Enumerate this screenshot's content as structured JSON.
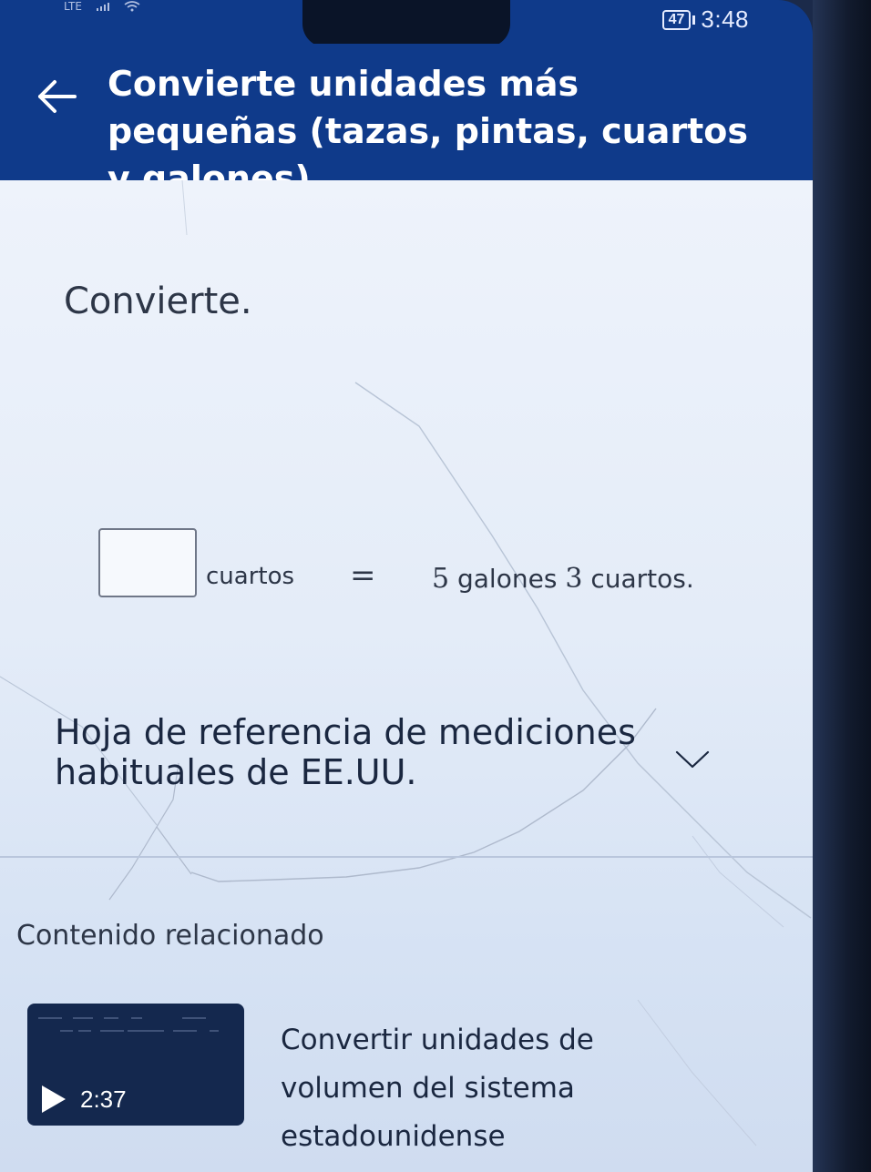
{
  "status_bar": {
    "network": "LTE",
    "battery": "47",
    "time": "3:48"
  },
  "header": {
    "title": "Convierte unidades más pequeñas (tazas, pintas, cuartos y galones)"
  },
  "exercise": {
    "prompt": "Convierte.",
    "answer_value": "",
    "unit_label": "cuartos",
    "equals": "=",
    "rhs_gallons": "5",
    "rhs_gallons_unit": "galones",
    "rhs_quarts": "3",
    "rhs_quarts_unit": "cuartos."
  },
  "reference": {
    "title": "Hoja de referencia de mediciones habituales de EE.UU."
  },
  "related": {
    "title": "Contenido relacionado",
    "video": {
      "duration": "2:37",
      "title": "Convertir unidades de volumen del sistema estadounidense"
    }
  },
  "colors": {
    "header_bg": "#0f3a8a",
    "content_bg": "#eef3fb",
    "text": "#2d3647"
  }
}
